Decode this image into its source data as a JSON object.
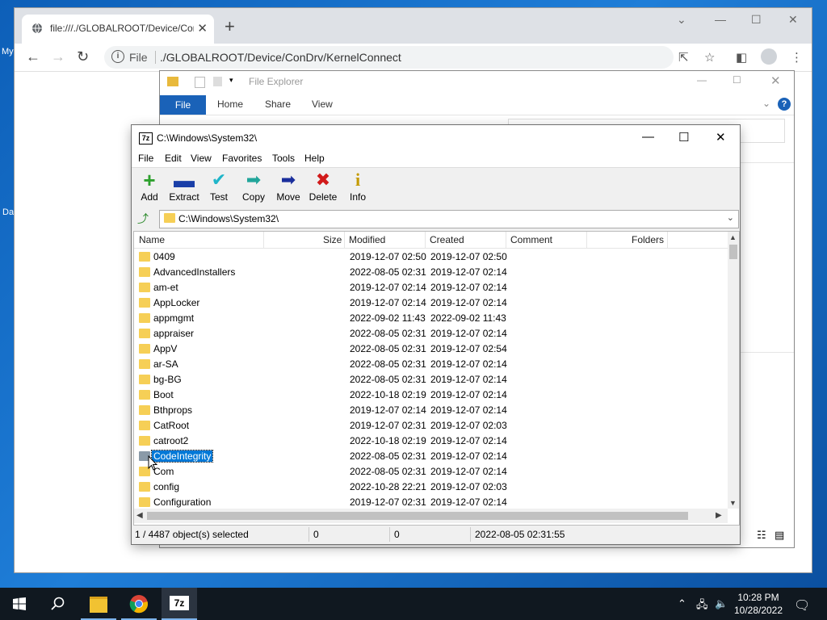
{
  "desktop": {
    "label1": "My",
    "label2": "Da"
  },
  "browser": {
    "tab_title": "file:///./GLOBALROOT/Device/Con",
    "omnibox_scheme": "File",
    "omnibox_url": "./GLOBALROOT/Device/ConDrv/KernelConnect"
  },
  "explorer": {
    "title": "File Explorer",
    "tabs": [
      "File",
      "Home",
      "Share",
      "View"
    ]
  },
  "sevenzip": {
    "title": "C:\\Windows\\System32\\",
    "menu": [
      "File",
      "Edit",
      "View",
      "Favorites",
      "Tools",
      "Help"
    ],
    "toolbar": [
      "Add",
      "Extract",
      "Test",
      "Copy",
      "Move",
      "Delete",
      "Info"
    ],
    "address": "C:\\Windows\\System32\\",
    "columns": {
      "name": "Name",
      "size": "Size",
      "modified": "Modified",
      "created": "Created",
      "comment": "Comment",
      "folders": "Folders"
    },
    "rows": [
      {
        "name": "0409",
        "modified": "2019-12-07 02:50",
        "created": "2019-12-07 02:50"
      },
      {
        "name": "AdvancedInstallers",
        "modified": "2022-08-05 02:31",
        "created": "2019-12-07 02:14"
      },
      {
        "name": "am-et",
        "modified": "2019-12-07 02:14",
        "created": "2019-12-07 02:14"
      },
      {
        "name": "AppLocker",
        "modified": "2019-12-07 02:14",
        "created": "2019-12-07 02:14"
      },
      {
        "name": "appmgmt",
        "modified": "2022-09-02 11:43",
        "created": "2022-09-02 11:43"
      },
      {
        "name": "appraiser",
        "modified": "2022-08-05 02:31",
        "created": "2019-12-07 02:14"
      },
      {
        "name": "AppV",
        "modified": "2022-08-05 02:31",
        "created": "2019-12-07 02:54"
      },
      {
        "name": "ar-SA",
        "modified": "2022-08-05 02:31",
        "created": "2019-12-07 02:14"
      },
      {
        "name": "bg-BG",
        "modified": "2022-08-05 02:31",
        "created": "2019-12-07 02:14"
      },
      {
        "name": "Boot",
        "modified": "2022-10-18 02:19",
        "created": "2019-12-07 02:14"
      },
      {
        "name": "Bthprops",
        "modified": "2019-12-07 02:14",
        "created": "2019-12-07 02:14"
      },
      {
        "name": "CatRoot",
        "modified": "2019-12-07 02:31",
        "created": "2019-12-07 02:03"
      },
      {
        "name": "catroot2",
        "modified": "2022-10-18 02:19",
        "created": "2019-12-07 02:14"
      },
      {
        "name": "CodeIntegrity",
        "modified": "2022-08-05 02:31",
        "created": "2019-12-07 02:14",
        "selected": true
      },
      {
        "name": "Com",
        "modified": "2022-08-05 02:31",
        "created": "2019-12-07 02:14"
      },
      {
        "name": "config",
        "modified": "2022-10-28 22:21",
        "created": "2019-12-07 02:03"
      },
      {
        "name": "Configuration",
        "modified": "2019-12-07 02:31",
        "created": "2019-12-07 02:14"
      }
    ],
    "status": {
      "selection": "1 / 4487 object(s) selected",
      "size1": "0",
      "size2": "0",
      "date": "2022-08-05 02:31:55"
    }
  },
  "taskbar": {
    "time": "10:28 PM",
    "date": "10/28/2022"
  }
}
